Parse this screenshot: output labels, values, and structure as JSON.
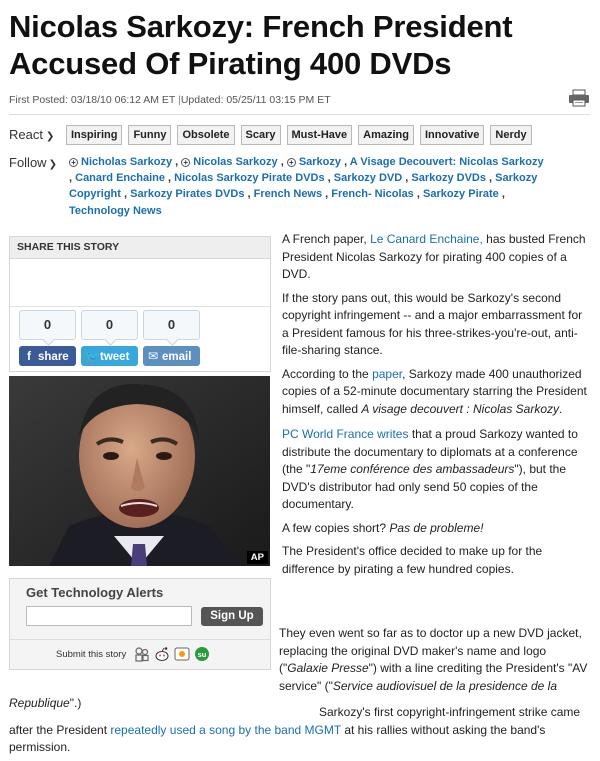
{
  "headline": {
    "line1": "Nicolas Sarkozy: French President",
    "line2": "Accused Of Pirating 400 DVDs"
  },
  "meta": {
    "posted": "First Posted: 03/18/10 06:12 AM ET",
    "separator": "|",
    "updated": "Updated: 05/25/11 03:15 PM ET"
  },
  "react": {
    "label": "React",
    "buttons": [
      "Inspiring",
      "Funny",
      "Obsolete",
      "Scary",
      "Must-Have",
      "Amazing",
      "Innovative",
      "Nerdy"
    ]
  },
  "follow": {
    "label": "Follow",
    "items": [
      {
        "text": "Nicholas Sarkozy",
        "plus": true
      },
      {
        "text": "Nicolas Sarkozy",
        "plus": true
      },
      {
        "text": "Sarkozy",
        "plus": true
      },
      {
        "text": "A Visage Decouvert: Nicolas Sarkozy",
        "plus": false
      },
      {
        "text": "Canard Enchaine",
        "plus": false
      },
      {
        "text": "Nicolas Sarkozy Pirate DVDs",
        "plus": false
      },
      {
        "text": "Sarkozy DVD",
        "plus": false
      },
      {
        "text": "Sarkozy DVDs",
        "plus": false
      },
      {
        "text": "Sarkozy Copyright",
        "plus": false
      },
      {
        "text": "Sarkozy Pirates DVDs",
        "plus": false
      },
      {
        "text": "French News",
        "plus": false
      },
      {
        "text": "French- Nicolas",
        "plus": false
      },
      {
        "text": "Sarkozy Pirate",
        "plus": false
      },
      {
        "text": "Technology News",
        "plus": false
      }
    ]
  },
  "share": {
    "title": "SHARE THIS STORY",
    "facebook": {
      "count": "0",
      "label": "share"
    },
    "twitter": {
      "count": "0",
      "label": "tweet"
    },
    "email": {
      "count": "0",
      "label": "email"
    }
  },
  "photo": {
    "credit": "AP"
  },
  "alerts": {
    "title": "Get Technology Alerts",
    "input_value": "",
    "button": "Sign Up",
    "submit_label": "Submit this story"
  },
  "article": {
    "p1": {
      "a": "A French paper, ",
      "link": "Le Canard Enchaine,",
      "b": " has busted French President Nicolas Sarkozy for pirating 400 copies of a DVD."
    },
    "p2": "If the story pans out, this would be Sarkozy's second copyright infringement -- and a major embarrassment for a President famous for his three-strikes-you're-out, anti-file-sharing stance.",
    "p3": {
      "a": "According to the ",
      "link": "paper",
      "b": ", Sarkozy made 400 unauthorized copies of a 52-minute documentary starring the President himself, called ",
      "em": "A visage decouvert : Nicolas Sarkozy",
      "c": "."
    },
    "p4": {
      "link": "PC World France writes",
      "a": " that a proud Sarkozy wanted to distribute the documentary to diplomats at a conference (the \"",
      "em": "17eme conférence des ambassadeurs",
      "b": "\"), but the DVD's distributor had only send 50 copies of the documentary."
    },
    "p5": {
      "a": "A few copies short? ",
      "em": "Pas de probleme!"
    },
    "p6": "The President's office decided to make up for the difference by pirating a few hundred copies.",
    "p7": {
      "a": "They even went so far as to doctor up a new DVD jacket, replacing the original DVD maker's name and logo (\"",
      "em1": "Galaxie Presse",
      "b": "\") with a line crediting the President's \"AV service\" (\"",
      "em2": "Service audiovisuel de la presidence de la Republique",
      "c": "\".)"
    },
    "p8": {
      "a": "Sarkozy's first copyright-infringement strike came after the President ",
      "link": "repeatedly used a song by the band MGMT",
      "b": " at his rallies without asking the band's permission."
    }
  }
}
